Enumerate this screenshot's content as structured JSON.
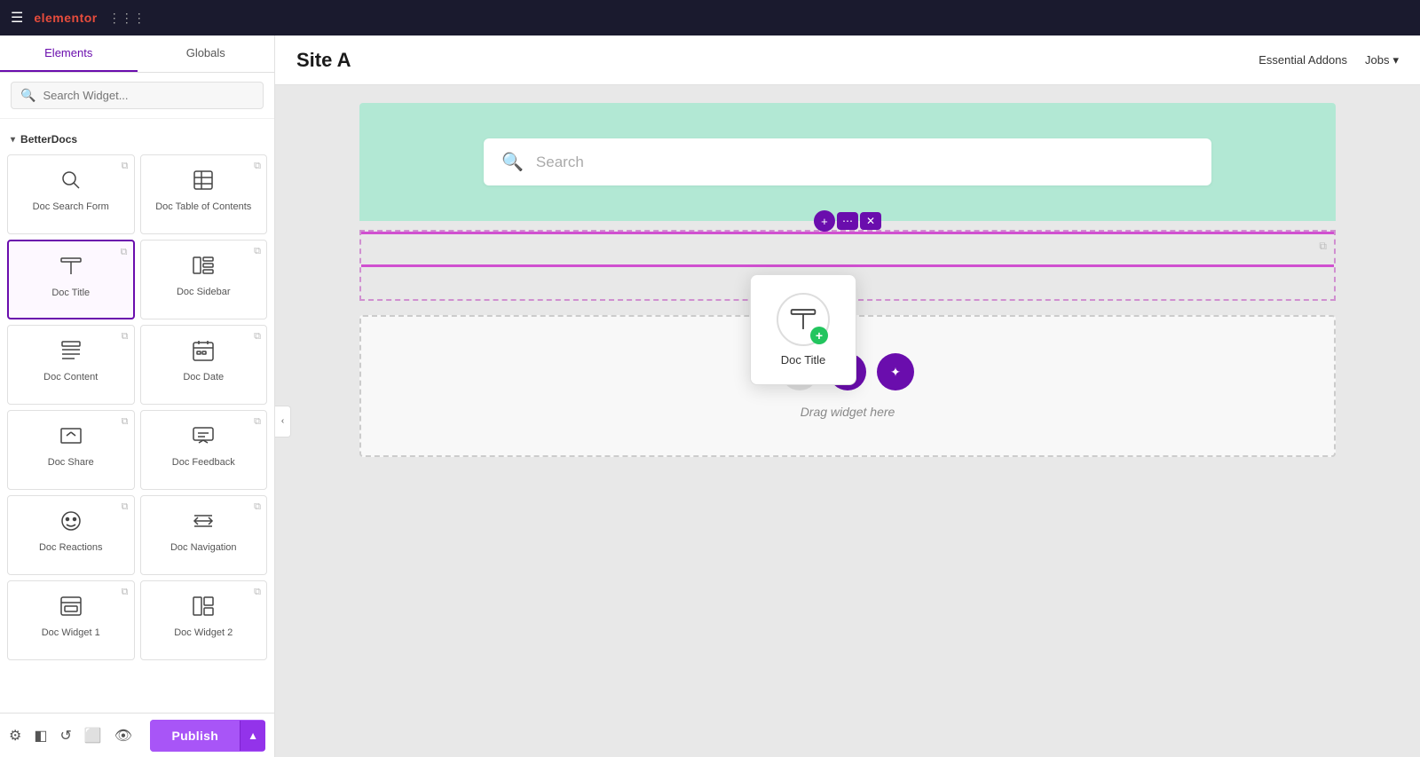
{
  "topbar": {
    "logo": "elementor",
    "hamburger_label": "☰",
    "grid_label": "⋮⋮⋮"
  },
  "sidebar": {
    "tabs": [
      {
        "id": "elements",
        "label": "Elements",
        "active": true
      },
      {
        "id": "globals",
        "label": "Globals",
        "active": false
      }
    ],
    "search": {
      "placeholder": "Search Widget..."
    },
    "section_label": "BetterDocs",
    "widgets": [
      {
        "id": "doc-search-form",
        "label": "Doc Search Form",
        "icon_type": "search",
        "selected": false
      },
      {
        "id": "doc-table-of-contents",
        "label": "Doc Table of Contents",
        "icon_type": "table",
        "selected": false
      },
      {
        "id": "doc-title",
        "label": "Doc Title",
        "icon_type": "title",
        "selected": true
      },
      {
        "id": "doc-sidebar",
        "label": "Doc Sidebar",
        "icon_type": "sidebar",
        "selected": false
      },
      {
        "id": "doc-content",
        "label": "Doc Content",
        "icon_type": "content",
        "selected": false
      },
      {
        "id": "doc-date",
        "label": "Doc Date",
        "icon_type": "date",
        "selected": false
      },
      {
        "id": "doc-share",
        "label": "Doc Share",
        "icon_type": "share",
        "selected": false
      },
      {
        "id": "doc-feedback",
        "label": "Doc Feedback",
        "icon_type": "feedback",
        "selected": false
      },
      {
        "id": "doc-reactions",
        "label": "Doc Reactions",
        "icon_type": "reactions",
        "selected": false
      },
      {
        "id": "doc-navigation",
        "label": "Doc Navigation",
        "icon_type": "navigation",
        "selected": false
      },
      {
        "id": "doc-w1",
        "label": "Doc Widget 1",
        "icon_type": "widget1",
        "selected": false
      },
      {
        "id": "doc-w2",
        "label": "Doc Widget 2",
        "icon_type": "widget2",
        "selected": false
      }
    ]
  },
  "bottom_bar": {
    "icons": [
      "settings",
      "layers",
      "history",
      "responsive",
      "preview"
    ],
    "publish_label": "Publish",
    "publish_expand": "▲"
  },
  "canvas": {
    "site_title": "Site A",
    "nav_links": [
      {
        "label": "Essential Addons"
      },
      {
        "label": "Jobs",
        "has_arrow": true
      }
    ],
    "search_placeholder": "Search",
    "drag_text": "Drag widget here",
    "widget_tooltip_label": "Doc Title",
    "drag_add_label": "+",
    "drag_folder_label": "🗀",
    "drag_magic_label": "✦"
  }
}
